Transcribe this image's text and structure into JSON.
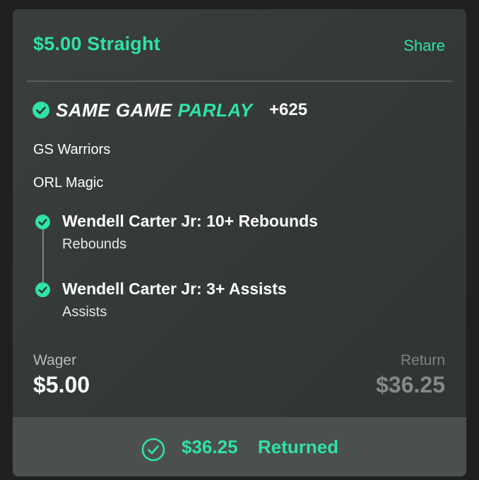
{
  "bet": {
    "title": "$5.00 Straight",
    "share_label": "Share"
  },
  "parlay": {
    "label_main": "SAME GAME",
    "label_accent": "PARLAY",
    "odds": "+625"
  },
  "teams": [
    "GS Warriors",
    "ORL Magic"
  ],
  "legs": [
    {
      "title": "Wendell Carter Jr: 10+ Rebounds",
      "market": "Rebounds"
    },
    {
      "title": "Wendell Carter Jr: 3+ Assists",
      "market": "Assists"
    }
  ],
  "wager": {
    "label": "Wager",
    "value": "$5.00"
  },
  "return": {
    "label": "Return",
    "value": "$36.25"
  },
  "footer": {
    "amount": "$36.25",
    "status": "Returned"
  },
  "colors": {
    "accent": "#2fe2a6",
    "card": "#373c3a",
    "footer": "#4b504e"
  },
  "icons": {
    "leg_status": "check-circle-icon",
    "result": "check-circle-outline-icon"
  }
}
